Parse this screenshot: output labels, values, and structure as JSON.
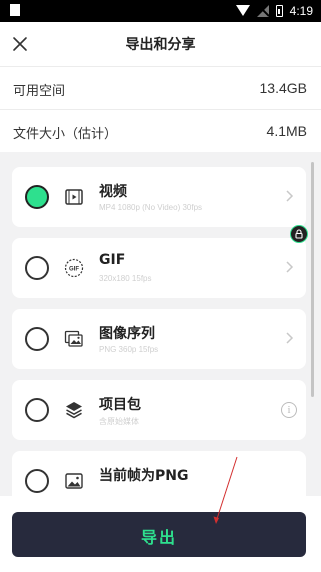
{
  "status_bar": {
    "time": "4:19",
    "icons": [
      "wifi-icon",
      "no-signal-icon",
      "battery-icon"
    ]
  },
  "header": {
    "title": "导出和分享",
    "close_icon": "close-icon"
  },
  "info": {
    "space_label": "可用空间",
    "space_value": "13.4GB",
    "size_label": "文件大小（估计）",
    "size_value": "4.1MB"
  },
  "options": [
    {
      "title": "视频",
      "subtitle": "MP4 1080p (No Video) 30fps",
      "icon": "video-icon",
      "selected": true,
      "trailing": "chevron-right-icon"
    },
    {
      "title": "GIF",
      "subtitle": "320x180 15fps",
      "icon": "gif-icon",
      "selected": false,
      "trailing": "chevron-right-icon"
    },
    {
      "title": "图像序列",
      "subtitle": "PNG 360p 15fps",
      "icon": "image-sequence-icon",
      "selected": false,
      "trailing": "chevron-right-icon"
    },
    {
      "title": "项目包",
      "subtitle": "含原始媒体",
      "icon": "layers-icon",
      "selected": false,
      "trailing": "info-icon",
      "badge": "lock-icon"
    },
    {
      "title": "当前帧为PNG",
      "subtitle": "",
      "icon": "image-icon",
      "selected": false
    }
  ],
  "info_glyph": "i",
  "gif_icon_text": "GIF",
  "export": {
    "label": "导出"
  },
  "colors": {
    "accent": "#2ee08e",
    "button_bg": "#272a3d",
    "list_bg": "#f2f2f3",
    "annotation_arrow": "#d32f2f"
  }
}
